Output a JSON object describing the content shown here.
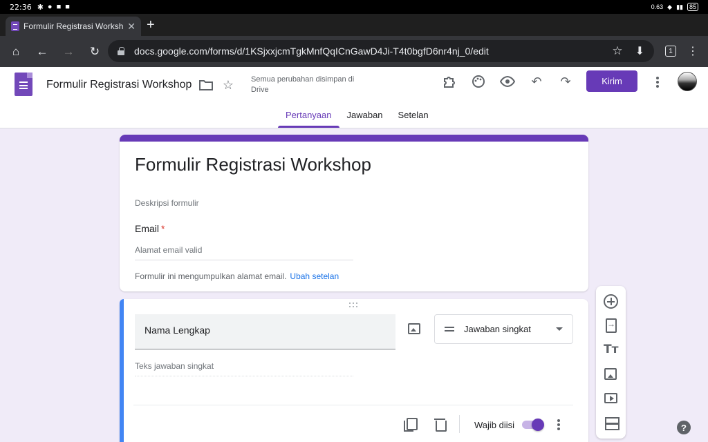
{
  "status_bar": {
    "time": "22:36",
    "net_speed": "0.63",
    "battery": "85"
  },
  "browser": {
    "tab_title": "Formulir Registrasi Workshop",
    "url": "docs.google.com/forms/d/1KSjxxjcmTgkMnfQqICnGawD4Ji-T4t0bgfD6nr4nj_0/edit",
    "tab_count": "1"
  },
  "forms_header": {
    "doc_title": "Formulir Registrasi Workshop",
    "save_status": "Semua perubahan disimpan di Drive",
    "send_label": "Kirim",
    "tabs": [
      {
        "label": "Pertanyaan",
        "active": true
      },
      {
        "label": "Jawaban",
        "active": false
      },
      {
        "label": "Setelan",
        "active": false
      }
    ]
  },
  "title_card": {
    "title": "Formulir Registrasi Workshop",
    "description_placeholder": "Deskripsi formulir",
    "email_label": "Email",
    "required_mark": "*",
    "email_placeholder": "Alamat email valid",
    "collect_note": "Formulir ini mengumpulkan alamat email.",
    "change_settings_link": "Ubah setelan"
  },
  "question_card": {
    "question_title": "Nama Lengkap",
    "question_type": "Jawaban singkat",
    "answer_placeholder": "Teks jawaban singkat",
    "required_label": "Wajib diisi",
    "required_on": true
  },
  "colors": {
    "accent": "#673ab7",
    "active_card_bar": "#4285f4",
    "page_bg": "#f0ebf8"
  }
}
